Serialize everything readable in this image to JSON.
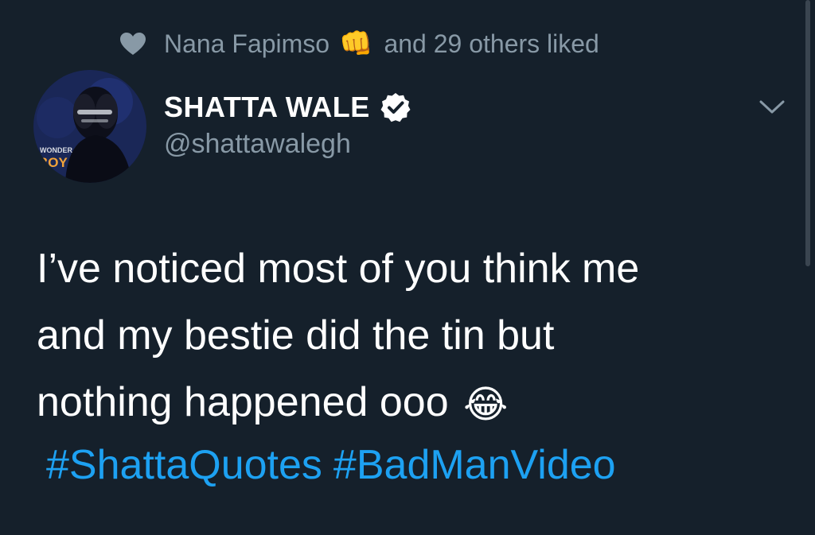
{
  "social_context": {
    "liker": "Nana Fapimso",
    "liker_emoji": "👊",
    "suffix": "and 29 others liked",
    "icon": "heart-icon"
  },
  "author": {
    "name": "SHATTA WALE",
    "handle": "@shattawalegh",
    "verified": true,
    "avatar_text_1": "WONDER",
    "avatar_text_2": "BOY"
  },
  "tweet": {
    "lines": [
      "I’ve noticed most of you think me",
      "and my bestie did the tin but",
      "nothing happened ooo"
    ],
    "emoji": "😂",
    "hashtags": [
      "#ShattaQuotes",
      "#BadManVideo"
    ]
  },
  "colors": {
    "background": "#15202b",
    "secondary_text": "#8899a6",
    "link": "#1da1f2",
    "primary_text": "#ffffff"
  }
}
